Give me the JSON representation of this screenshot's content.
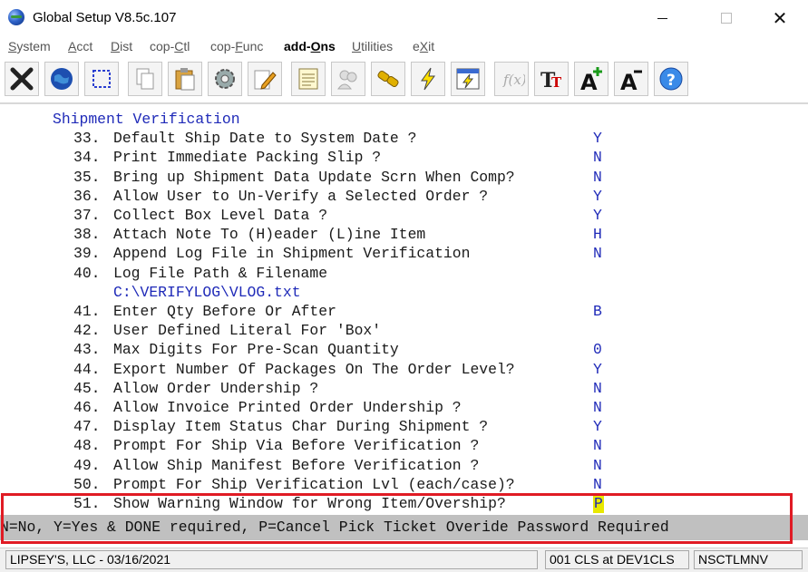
{
  "window": {
    "title": "Global Setup V8.5c.107",
    "controls": {
      "minimize": "—",
      "maximize": "☐",
      "close": "✕"
    }
  },
  "menu": [
    "System",
    "Acct",
    "Dist",
    "cop-Ctl",
    "cop-Func",
    "add-Ons",
    "Utilities",
    "eXit"
  ],
  "active_menu": "add-Ons",
  "toolbar_icons": [
    "exit-icon",
    "globe-icon",
    "select-icon",
    "copy-icon",
    "paste-icon",
    "settings-icon",
    "edit-icon",
    "notes-icon",
    "users-icon",
    "link-icon",
    "lightning-icon",
    "window-lightning-icon",
    "function-icon",
    "font-icon",
    "font-larger-icon",
    "font-smaller-icon",
    "help-icon"
  ],
  "screen": {
    "section_title": "Shipment Verification",
    "items": [
      {
        "num": "33.",
        "label": "Default Ship Date to System Date ?",
        "value": "Y"
      },
      {
        "num": "34.",
        "label": "Print Immediate Packing Slip ?",
        "value": "N"
      },
      {
        "num": "35.",
        "label": "Bring up Shipment Data Update Scrn When Comp?",
        "value": "N"
      },
      {
        "num": "36.",
        "label": "Allow User to Un-Verify a Selected Order ?",
        "value": "Y"
      },
      {
        "num": "37.",
        "label": "Collect Box Level Data ?",
        "value": "Y"
      },
      {
        "num": "38.",
        "label": "Attach Note To (H)eader (L)ine Item",
        "value": "H"
      },
      {
        "num": "39.",
        "label": "Append Log File in Shipment Verification",
        "value": "N"
      },
      {
        "num": "40.",
        "label": "Log File Path & Filename",
        "value": ""
      },
      {
        "num": "41.",
        "label": "Enter Qty Before Or After",
        "value": "B"
      },
      {
        "num": "42.",
        "label": "User Defined Literal For 'Box'",
        "value": ""
      },
      {
        "num": "43.",
        "label": "Max Digits For Pre-Scan Quantity",
        "value": "0"
      },
      {
        "num": "44.",
        "label": "Export Number Of Packages On The Order Level?",
        "value": "Y"
      },
      {
        "num": "45.",
        "label": "Allow Order Undership ?",
        "value": "N"
      },
      {
        "num": "46.",
        "label": "Allow Invoice Printed Order Undership ?",
        "value": "N"
      },
      {
        "num": "47.",
        "label": "Display Item Status Char During Shipment ?",
        "value": "Y"
      },
      {
        "num": "48.",
        "label": "Prompt For Ship Via Before Verification ?",
        "value": "N"
      },
      {
        "num": "49.",
        "label": "Allow Ship Manifest Before Verification ?",
        "value": "N"
      },
      {
        "num": "50.",
        "label": "Prompt For Ship Verification Lvl (each/case)?",
        "value": "N"
      },
      {
        "num": "51.",
        "label": "Show Warning Window for Wrong Item/Overship?",
        "value": "P"
      }
    ],
    "log_path": "C:\\VERIFYLOG\\VLOG.txt",
    "help_text": "N=No, Y=Yes & DONE required, P=Cancel Pick Ticket Overide Password Required"
  },
  "status": {
    "company": "LIPSEY'S, LLC - 03/16/2021",
    "location": "001 CLS at DEV1CLS",
    "program": "NSCTLMNV"
  },
  "colors": {
    "value_blue": "#1f2ab8",
    "help_bar": "#c0c0c0",
    "highlight_red": "#e01b24",
    "cursor_yellow": "#e8e800"
  }
}
